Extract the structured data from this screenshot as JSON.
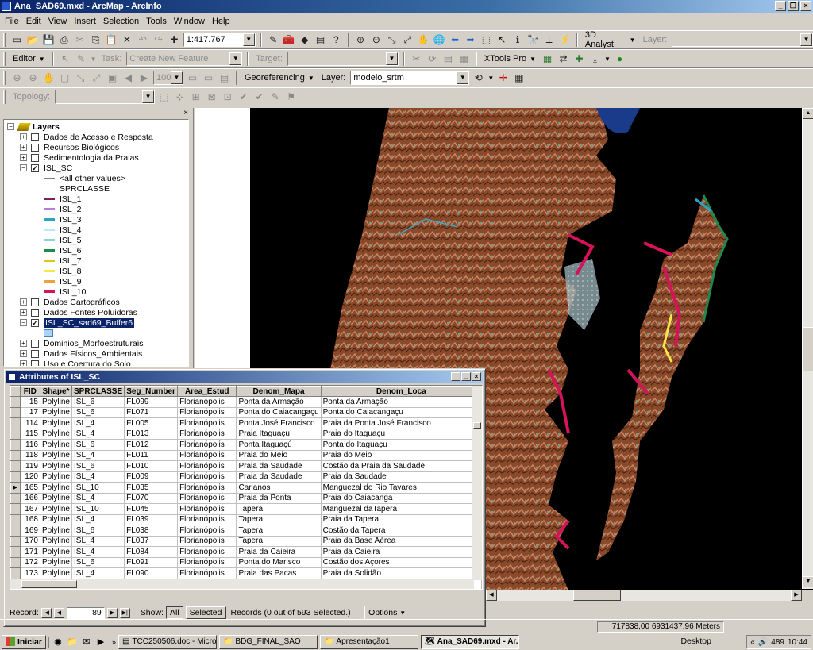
{
  "window": {
    "title": "Ana_SAD69.mxd - ArcMap - ArcInfo"
  },
  "menu": [
    "File",
    "Edit",
    "View",
    "Insert",
    "Selection",
    "Tools",
    "Window",
    "Help"
  ],
  "toolbar1": {
    "scale": "1:417.767",
    "analyst": "3D Analyst",
    "layer_label": "Layer:",
    "layer_value": ""
  },
  "toolbar2": {
    "editor": "Editor",
    "task_label": "Task:",
    "task_value": "Create New Feature",
    "target_label": "Target:",
    "target_value": "",
    "xtools": "XTools Pro"
  },
  "toolbar3": {
    "zoom": "100%",
    "georef": "Georeferencing",
    "layer_label": "Layer:",
    "layer_value": "modelo_srtm"
  },
  "toolbar4": {
    "topology_label": "Topology:"
  },
  "toc": {
    "root": "Layers",
    "items": [
      "Dados de Acesso e Resposta",
      "Recursos Biológicos",
      "Sedimentologia da Praias",
      "ISL_SC",
      "<all other values>",
      "SPRCLASSE",
      "ISL_1",
      "ISL_2",
      "ISL_3",
      "ISL_4",
      "ISL_5",
      "ISL_6",
      "ISL_7",
      "ISL_8",
      "ISL_9",
      "ISL_10",
      "Dados Cartográficos",
      "Dados Fontes Poluidoras",
      "ISL_SC_sad69_Buffer6",
      "Dominios_Morfoestruturais",
      "Dados Físicos_Ambientais",
      "Uso e Coertura do Solo"
    ],
    "legend_colors": [
      "#7a1f5c",
      "#b57fd6",
      "#2aa5c8",
      "#bfe6f5",
      "#8fd3c8",
      "#1f8a4c",
      "#d9c91c",
      "#f7e84a",
      "#f0a040",
      "#d4145a"
    ]
  },
  "attributes": {
    "title": "Attributes of ISL_SC",
    "columns": [
      "FID",
      "Shape*",
      "SPRCLASSE",
      "Seg_Number",
      "Area_Estud",
      "Denom_Mapa",
      "Denom_Loca"
    ],
    "rows": [
      [
        "15",
        "Polyline",
        "ISL_6",
        "FL099",
        "Florianópolis",
        "Ponta da Armação",
        "Ponta da Armação"
      ],
      [
        "17",
        "Polyline",
        "ISL_6",
        "FL071",
        "Florianópolis",
        "Ponta do Caiacangaçu",
        "Ponta do Caiacangaçu"
      ],
      [
        "114",
        "Polyline",
        "ISL_4",
        "FL005",
        "Florianópolis",
        "Ponta José Francisco",
        "Praia da Ponta José Francisco"
      ],
      [
        "115",
        "Polyline",
        "ISL_4",
        "FL013",
        "Florianópolis",
        "Praia Itaguaçu",
        "Praia do Itaguaçu"
      ],
      [
        "116",
        "Polyline",
        "ISL_6",
        "FL012",
        "Florianópolis",
        "Ponta Itaguaçú",
        "Ponta do Itaguaçu"
      ],
      [
        "118",
        "Polyline",
        "ISL_4",
        "FL011",
        "Florianópolis",
        "Praia do Meio",
        "Praia do Meio"
      ],
      [
        "119",
        "Polyline",
        "ISL_6",
        "FL010",
        "Florianópolis",
        "Praia da Saudade",
        "Costão da Praia da Saudade"
      ],
      [
        "120",
        "Polyline",
        "ISL_4",
        "FL009",
        "Florianópolis",
        "Praia da Saudade",
        "Praia da Saudade"
      ],
      [
        "165",
        "Polyline",
        "ISL_10",
        "FL035",
        "Florianópolis",
        "Carianos",
        "Manguezal do Rio Tavares"
      ],
      [
        "166",
        "Polyline",
        "ISL_4",
        "FL070",
        "Florianópolis",
        "Praia da Ponta",
        "Praia do Caiacanga"
      ],
      [
        "167",
        "Polyline",
        "ISL_10",
        "FL045",
        "Florianópolis",
        "Tapera",
        "Manguezal daTapera"
      ],
      [
        "168",
        "Polyline",
        "ISL_4",
        "FL039",
        "Florianópolis",
        "Tapera",
        "Praia da Tapera"
      ],
      [
        "169",
        "Polyline",
        "ISL_6",
        "FL038",
        "Florianópolis",
        "Tapera",
        "Costão da Tapera"
      ],
      [
        "170",
        "Polyline",
        "ISL_4",
        "FL037",
        "Florianópolis",
        "Tapera",
        "Praia da Base Aérea"
      ],
      [
        "171",
        "Polyline",
        "ISL_4",
        "FL084",
        "Florianópolis",
        "Praia da Caieira",
        "Praia da Caieira"
      ],
      [
        "172",
        "Polyline",
        "ISL_6",
        "FL091",
        "Florianópolis",
        "Ponta do Marisco",
        "Costão dos Açores"
      ],
      [
        "173",
        "Polyline",
        "ISL_4",
        "FL090",
        "Florianópolis",
        "Praia das Pacas",
        "Praia da Solidão"
      ],
      [
        "174",
        "Polyline",
        "ISL_6",
        "FL103",
        "Florianópolis",
        "Morro das Pedras",
        "Morro das Pedras"
      ]
    ],
    "current_row_index": 8,
    "record_label": "Record:",
    "record_value": "89",
    "show_label": "Show:",
    "show_all": "All",
    "show_selected": "Selected",
    "records_text": "Records (0 out of 593 Selected.)",
    "options": "Options"
  },
  "status": {
    "coords": "717838,00  6931437,96 Meters"
  },
  "taskbar": {
    "start": "Iniciar",
    "tasks": [
      "TCC250506.doc - Micros...",
      "BDG_FINAL_SAO",
      "Apresentação1",
      "Ana_SAD69.mxd - Ar..."
    ],
    "active_index": 3,
    "desktop": "Desktop",
    "tray_num": "489",
    "clock": "10:44"
  },
  "icons": [
    "new-icon",
    "open-icon",
    "save-icon",
    "print-icon",
    "cut-icon",
    "copy-icon",
    "paste-icon",
    "delete-icon",
    "undo-icon",
    "redo-icon",
    "add-data-icon",
    "zoom-in-icon",
    "zoom-out-icon",
    "pan-icon",
    "full-extent-icon",
    "back-icon",
    "forward-icon",
    "select-icon",
    "identify-icon",
    "find-icon",
    "measure-icon",
    "hyperlink-icon"
  ]
}
